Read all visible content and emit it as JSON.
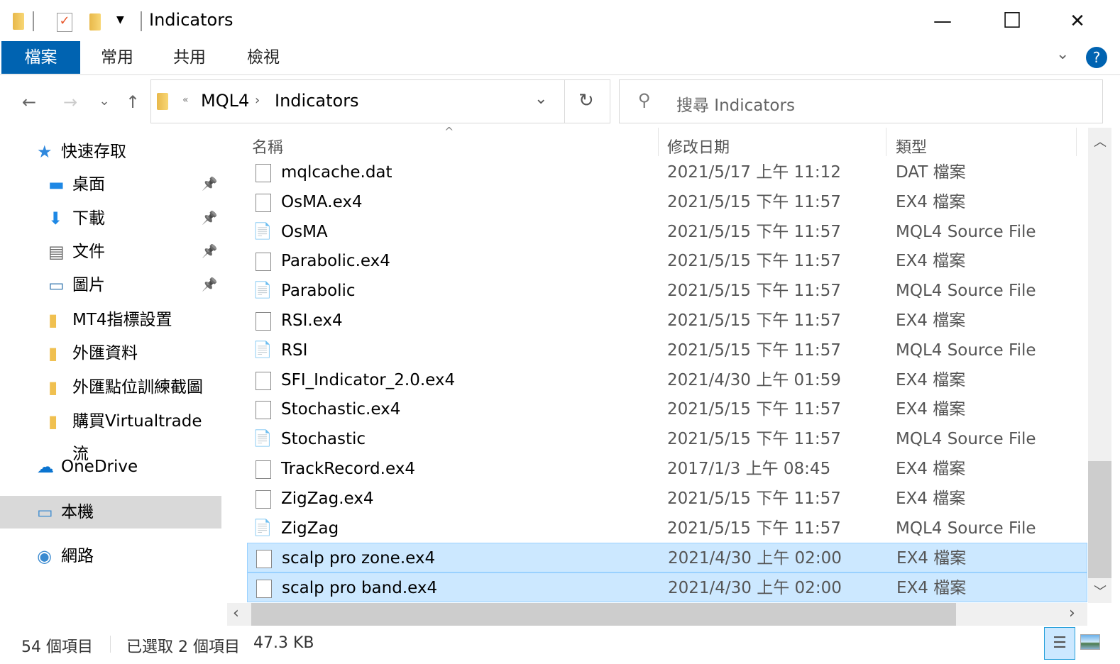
{
  "window": {
    "title": "Indicators",
    "minimize": "—",
    "maximize": "☐",
    "close": "✕"
  },
  "ribbon": {
    "tabs": [
      "檔案",
      "常用",
      "共用",
      "檢視"
    ],
    "help": "?"
  },
  "address": {
    "overflow": "«",
    "crumbs": [
      "MQL4",
      "Indicators"
    ]
  },
  "search": {
    "placeholder": "搜尋 Indicators"
  },
  "sidebar": {
    "items": [
      {
        "label": "快速存取",
        "icon": "star-icon"
      },
      {
        "label": "桌面",
        "icon": "desktop-icon",
        "pinned": true
      },
      {
        "label": "下載",
        "icon": "download-icon",
        "pinned": true
      },
      {
        "label": "文件",
        "icon": "document-icon",
        "pinned": true
      },
      {
        "label": "圖片",
        "icon": "pictures-icon",
        "pinned": true
      },
      {
        "label": "MT4指標設置",
        "icon": "folder-icon"
      },
      {
        "label": "外匯資料",
        "icon": "folder-icon"
      },
      {
        "label": "外匯點位訓練截圖",
        "icon": "folder-icon"
      },
      {
        "label": "購買Virtualtrade 流",
        "icon": "folder-icon"
      },
      {
        "label": "OneDrive",
        "icon": "cloud-icon"
      },
      {
        "label": "本機",
        "icon": "computer-icon",
        "selected": true
      },
      {
        "label": "網路",
        "icon": "network-icon"
      }
    ]
  },
  "columns": {
    "name": "名稱",
    "date": "修改日期",
    "type": "類型"
  },
  "files": [
    {
      "name": "mqlcache.dat",
      "date": "2021/5/17 上午 11:12",
      "type": "DAT 檔案",
      "kind": "file"
    },
    {
      "name": "OsMA.ex4",
      "date": "2021/5/15 下午 11:57",
      "type": "EX4 檔案",
      "kind": "file"
    },
    {
      "name": "OsMA",
      "date": "2021/5/15 下午 11:57",
      "type": "MQL4 Source File",
      "kind": "mql"
    },
    {
      "name": "Parabolic.ex4",
      "date": "2021/5/15 下午 11:57",
      "type": "EX4 檔案",
      "kind": "file"
    },
    {
      "name": "Parabolic",
      "date": "2021/5/15 下午 11:57",
      "type": "MQL4 Source File",
      "kind": "mql"
    },
    {
      "name": "RSI.ex4",
      "date": "2021/5/15 下午 11:57",
      "type": "EX4 檔案",
      "kind": "file"
    },
    {
      "name": "RSI",
      "date": "2021/5/15 下午 11:57",
      "type": "MQL4 Source File",
      "kind": "mql"
    },
    {
      "name": "SFI_Indicator_2.0.ex4",
      "date": "2021/4/30 上午 01:59",
      "type": "EX4 檔案",
      "kind": "file"
    },
    {
      "name": "Stochastic.ex4",
      "date": "2021/5/15 下午 11:57",
      "type": "EX4 檔案",
      "kind": "file"
    },
    {
      "name": "Stochastic",
      "date": "2021/5/15 下午 11:57",
      "type": "MQL4 Source File",
      "kind": "mql"
    },
    {
      "name": "TrackRecord.ex4",
      "date": "2017/1/3 上午 08:45",
      "type": "EX4 檔案",
      "kind": "file"
    },
    {
      "name": "ZigZag.ex4",
      "date": "2021/5/15 下午 11:57",
      "type": "EX4 檔案",
      "kind": "file"
    },
    {
      "name": "ZigZag",
      "date": "2021/5/15 下午 11:57",
      "type": "MQL4 Source File",
      "kind": "mql"
    },
    {
      "name": "scalp pro zone.ex4",
      "date": "2021/4/30 上午 02:00",
      "type": "EX4 檔案",
      "kind": "file",
      "selected": true
    },
    {
      "name": "scalp pro band.ex4",
      "date": "2021/4/30 上午 02:00",
      "type": "EX4 檔案",
      "kind": "file",
      "selected": true
    }
  ],
  "status": {
    "count": "54 個項目",
    "selected": "已選取 2 個項目",
    "size": "47.3 KB"
  },
  "colors": {
    "accent": "#0063b1",
    "selection": "#cce8ff",
    "selection_border": "#99d1ff"
  }
}
